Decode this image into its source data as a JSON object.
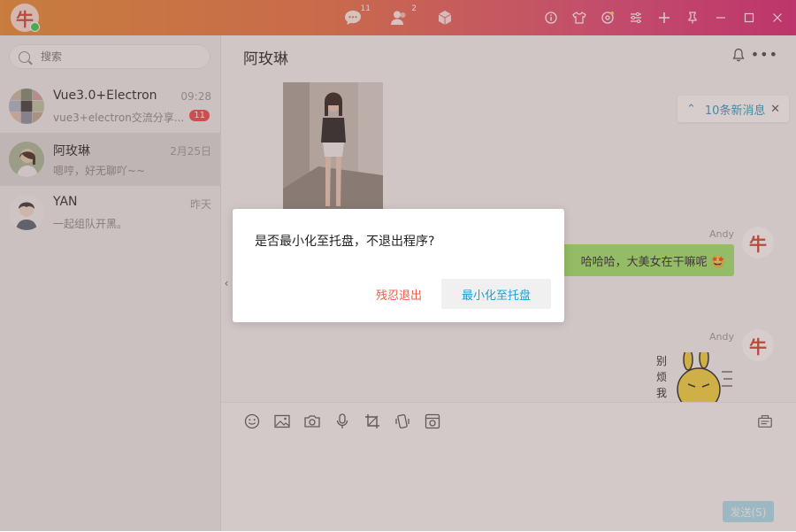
{
  "app": {
    "logo_char": "牛"
  },
  "titlebar": {
    "chat_badge": "11",
    "contacts_badge": "2"
  },
  "sidebar": {
    "search": {
      "placeholder": "搜索"
    },
    "conversations": [
      {
        "name": "Vue3.0+Electron",
        "time": "09:28",
        "last_message": "vue3+electron交流分享...",
        "badge": "11"
      },
      {
        "name": "阿玫琳",
        "time": "2月25日",
        "last_message": "嗯哼，好无聊吖~~"
      },
      {
        "name": "YAN",
        "time": "昨天",
        "last_message": "一起组队开黑。"
      }
    ]
  },
  "chat": {
    "title": "阿玫琳",
    "new_messages": "10条新消息",
    "messages": [
      {
        "sender": "Andy",
        "text": "哈哈哈，大美女在干嘛呢 🤩"
      },
      {
        "sender": "Andy",
        "sticker_text": "别烦我"
      }
    ],
    "send_label": "发送(S)"
  },
  "dialog": {
    "message": "是否最小化至托盘，不退出程序?",
    "exit_label": "残忍退出",
    "minimize_label": "最小化至托盘"
  },
  "colors": {
    "accent": "#1aa0d7",
    "danger": "#f05a49",
    "bubble": "#9de567",
    "badge": "#f04444"
  }
}
